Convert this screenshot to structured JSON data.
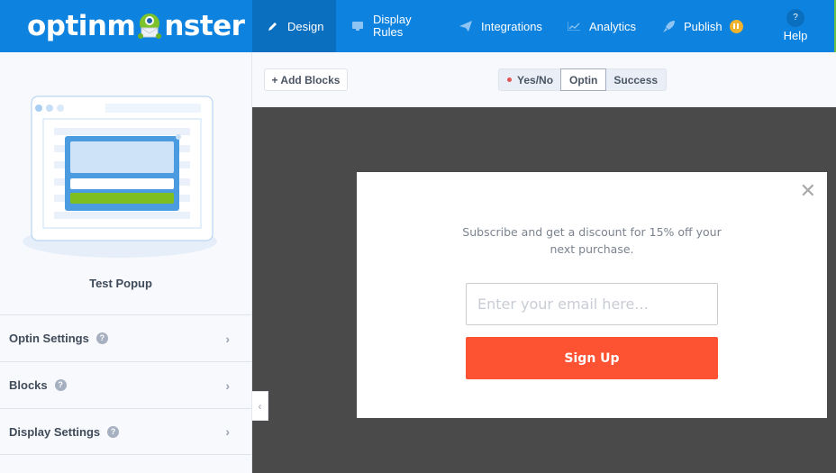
{
  "header": {
    "logo_text_left": "optinm",
    "logo_text_right": "nster",
    "nav": [
      {
        "label": "Design",
        "icon": "pencil-icon",
        "active": true
      },
      {
        "label_line1": "Display",
        "label_line2": "Rules",
        "icon": "monitor-icon"
      },
      {
        "label": "Integrations",
        "icon": "paper-plane-icon"
      },
      {
        "label": "Analytics",
        "icon": "chart-line-icon"
      },
      {
        "label": "Publish",
        "icon": "rocket-icon",
        "badge_icon": "pause-icon"
      }
    ],
    "help": {
      "icon": "?",
      "label": "Help"
    },
    "colors": {
      "topbar": "#0d82df",
      "active": "#0b6fc0",
      "badge": "#f0b32e"
    }
  },
  "sidebar": {
    "campaign_name": "Test Popup",
    "sections": [
      {
        "label": "Optin Settings"
      },
      {
        "label": "Blocks"
      },
      {
        "label": "Display Settings"
      }
    ],
    "help_glyph": "?",
    "chevron_glyph": "›",
    "collapse_glyph": "‹"
  },
  "toolbar": {
    "add_blocks": "+ Add Blocks",
    "views": [
      {
        "label": "Yes/No",
        "dot": true
      },
      {
        "label": "Optin",
        "selected": true
      },
      {
        "label": "Success"
      }
    ]
  },
  "popup": {
    "close_glyph": "✕",
    "text": "Subscribe and get a discount for 15% off your next purchase.",
    "email_placeholder": "Enter your email here...",
    "email_value": "",
    "button_label": "Sign Up",
    "button_color": "#fe5332"
  }
}
